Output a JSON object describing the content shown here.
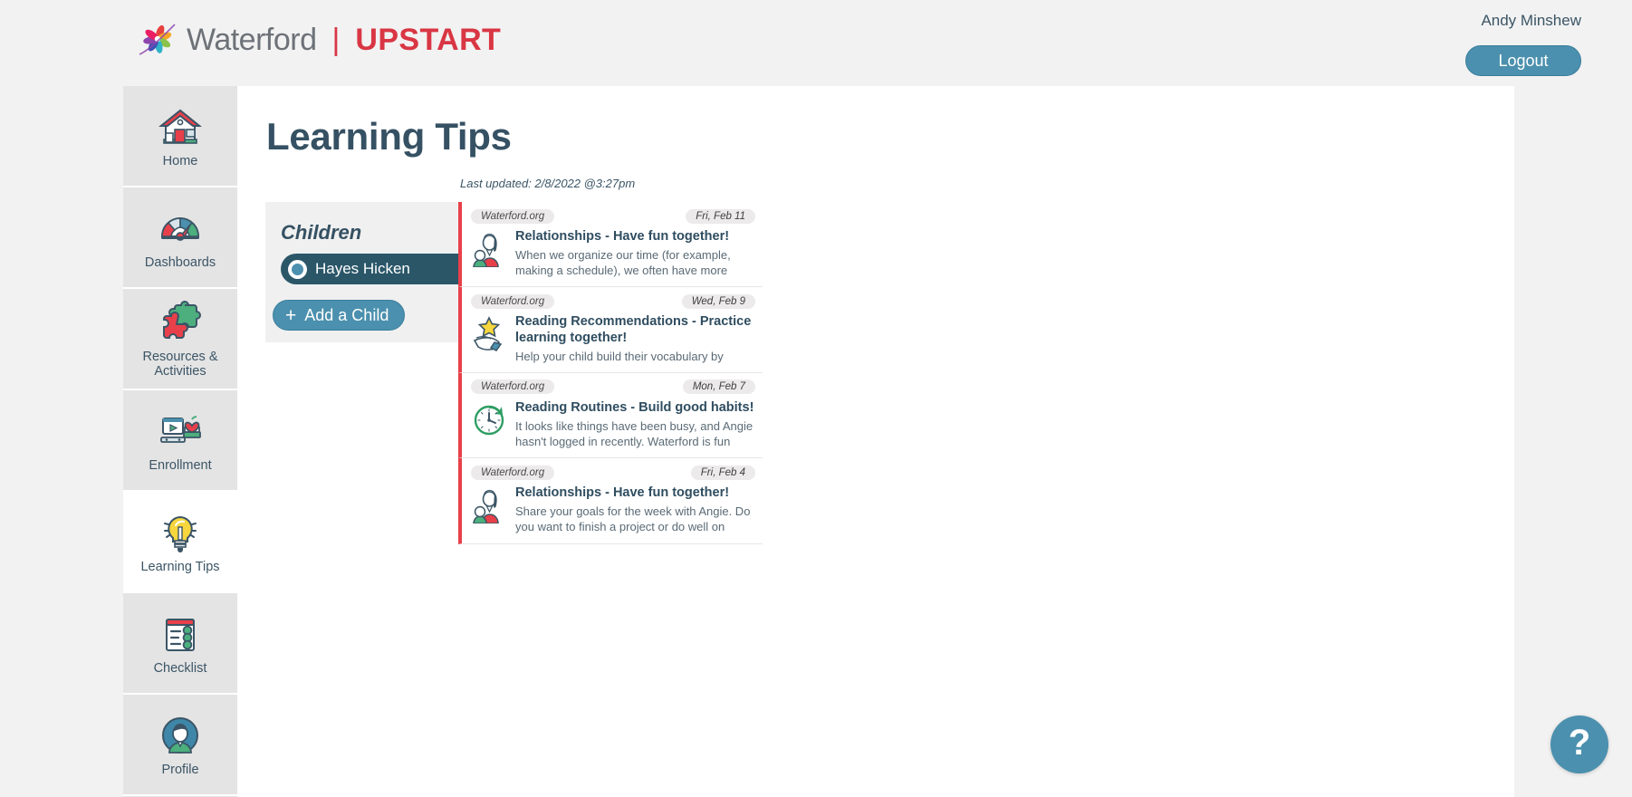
{
  "brand": {
    "word": "Waterford",
    "divider": "|",
    "upstart": "UPSTART"
  },
  "header": {
    "user_name": "Andy Minshew",
    "logout_label": "Logout"
  },
  "sidebar": {
    "items": [
      {
        "label": "Home",
        "icon": "house-icon",
        "active": false
      },
      {
        "label": "Dashboards",
        "icon": "gauge-icon",
        "active": false
      },
      {
        "label": "Resources & Activities",
        "icon": "puzzle-icon",
        "active": false
      },
      {
        "label": "Enrollment",
        "icon": "desk-apple-icon",
        "active": false
      },
      {
        "label": "Learning Tips",
        "icon": "lightbulb-icon",
        "active": true
      },
      {
        "label": "Checklist",
        "icon": "clipboard-check-icon",
        "active": false
      },
      {
        "label": "Profile",
        "icon": "avatar-icon",
        "active": false
      }
    ]
  },
  "main": {
    "page_title": "Learning Tips",
    "children_panel": {
      "heading": "Children",
      "selected_child": "Hayes Hicken",
      "add_child_label": "Add a Child",
      "plus_glyph": "+"
    },
    "tips": {
      "last_updated": "Last updated: 2/8/2022 @3:27pm",
      "items": [
        {
          "source": "Waterford.org",
          "date": "Fri, Feb 11",
          "title": "Relationships - Have fun together!",
          "snippet": "When we organize our time (for example, making a schedule), we often have more",
          "icon": "parent-child-icon"
        },
        {
          "source": "Waterford.org",
          "date": "Wed, Feb 9",
          "title": "Reading Recommendations - Practice learning together!",
          "snippet": "Help your child build their vocabulary by",
          "icon": "hand-star-icon"
        },
        {
          "source": "Waterford.org",
          "date": "Mon, Feb 7",
          "title": "Reading Routines - Build good habits!",
          "snippet": "It looks like things have been busy, and Angie hasn't logged in recently. Waterford is fun",
          "icon": "clock-icon"
        },
        {
          "source": "Waterford.org",
          "date": "Fri, Feb 4",
          "title": "Relationships - Have fun together!",
          "snippet": "Share your goals for the week with Angie. Do you want to finish a project or do well on",
          "icon": "parent-child-icon"
        }
      ]
    }
  },
  "help": {
    "icon": "question-mark-icon",
    "glyph": "?"
  },
  "colors": {
    "brand_red": "#d93644",
    "accent_blue": "#4b90ae",
    "dark_teal": "#2a5668",
    "slate": "#355163",
    "card_accent": "#e8404a"
  }
}
